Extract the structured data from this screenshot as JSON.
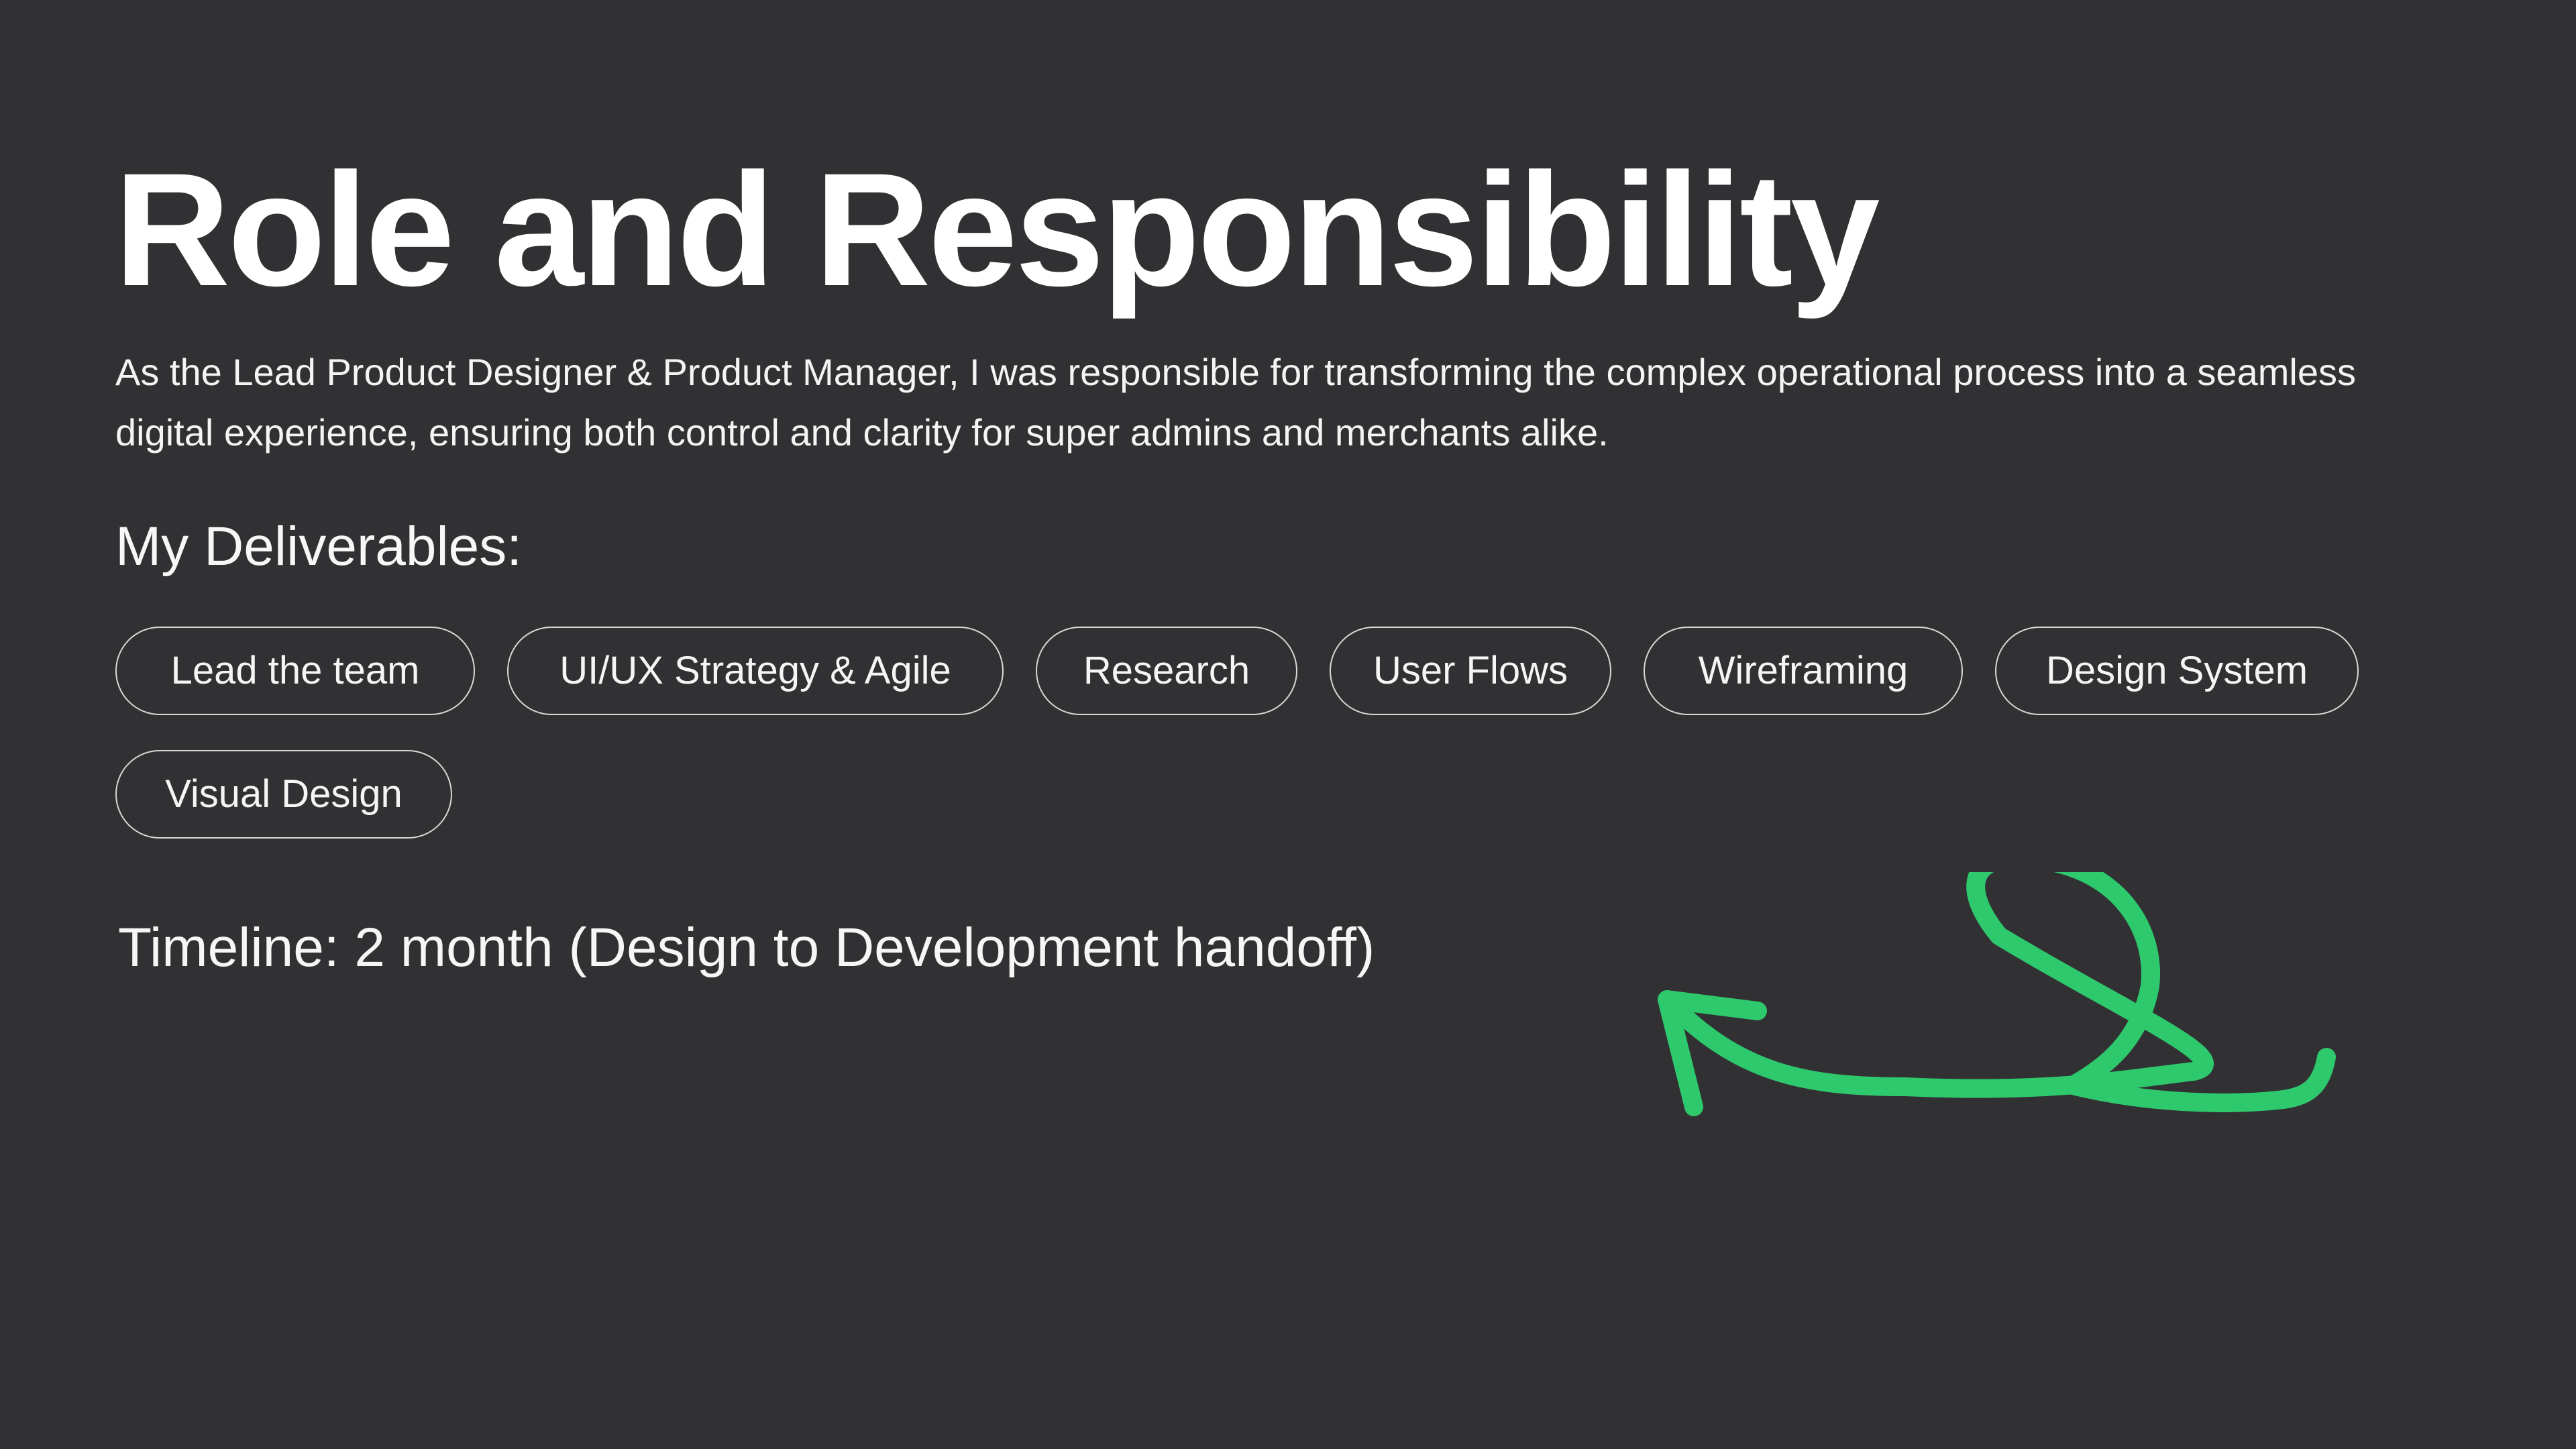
{
  "page": {
    "title": "Role and Responsibility",
    "description": "As the Lead Product Designer & Product Manager, I was responsible for transforming the complex operational process into a seamless digital experience, ensuring both control and clarity for super admins and merchants alike.",
    "deliverables_heading": "My Deliverables:",
    "deliverables": [
      "Lead the team",
      "UI/UX Strategy & Agile",
      "Research",
      "User Flows",
      "Wireframing",
      "Design System",
      "Visual Design"
    ],
    "timeline": "Timeline: 2 month (Design to Development handoff)"
  },
  "colors": {
    "background": "#313133",
    "text": "#ffffff",
    "pill_border": "#d8d8d8",
    "accent": "#2ec96d"
  },
  "icons": {
    "doodle": "green-loop-arrow-icon"
  }
}
